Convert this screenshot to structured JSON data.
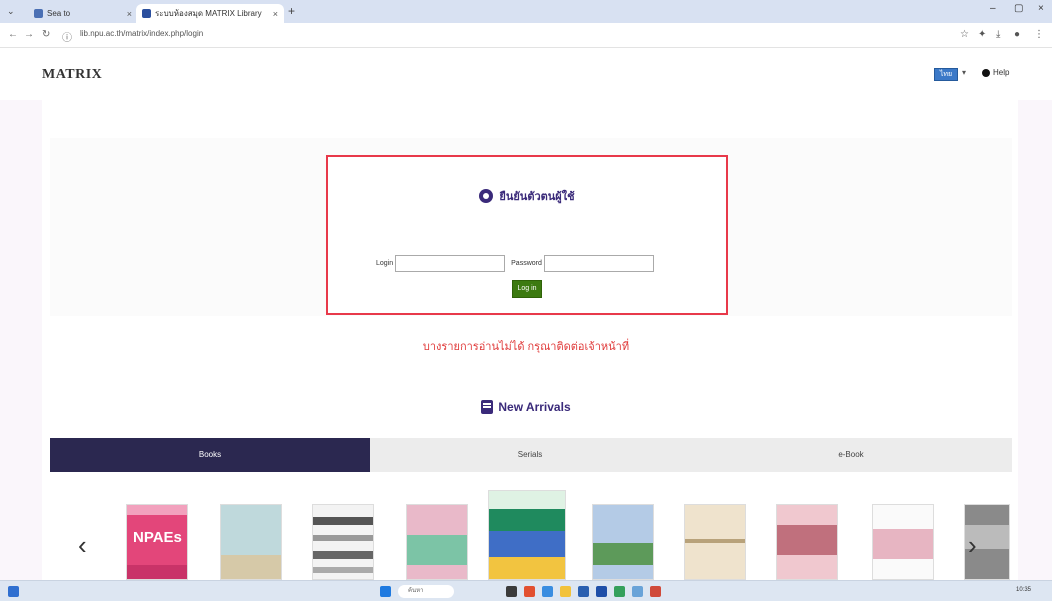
{
  "browser": {
    "tabs": [
      {
        "title": "Sea to",
        "active": false
      },
      {
        "title": "ระบบห้องสมุด MATRIX Library",
        "active": true
      }
    ],
    "url": "lib.npu.ac.th/matrix/index.php/login",
    "window_controls": [
      "–",
      "▢",
      "×"
    ],
    "toolbar_icons": [
      "star-icon",
      "extension-icon",
      "download-icon",
      "profile-icon",
      "menu-icon"
    ]
  },
  "site": {
    "logo": "MATRIX",
    "language": "ไทย",
    "language_caret": "▾",
    "help": "Help"
  },
  "login": {
    "title": "ยืนยันตัวตนผู้ใช้",
    "login_label": "Login",
    "password_label": "Password",
    "login_value": "",
    "password_value": "",
    "button": "Log in"
  },
  "warning": "บางรายการอ่านไม่ได้ กรุณาติดต่อเจ้าหน้าที่",
  "arrivals": {
    "title": "New Arrivals",
    "tabs": [
      "Books",
      "Serials",
      "e-Book"
    ],
    "active_tab": 0,
    "prev": "‹",
    "next": "›",
    "covers": [
      {
        "label": "NPAEs"
      },
      {
        "label": ""
      },
      {
        "label": ""
      },
      {
        "label": ""
      },
      {
        "label": ""
      },
      {
        "label": ""
      },
      {
        "label": ""
      },
      {
        "label": ""
      },
      {
        "label": ""
      },
      {
        "label": ""
      }
    ]
  },
  "taskbar": {
    "search_placeholder": "ค้นหา",
    "clock": "10:35"
  },
  "colors": {
    "accent_purple": "#3a2a7a",
    "login_border": "#e8394a",
    "warning_red": "#e03a3a",
    "login_button": "#3c7a10",
    "active_tab": "#2b2850"
  }
}
